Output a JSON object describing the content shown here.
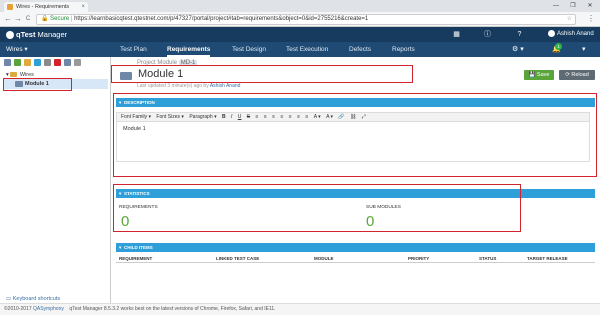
{
  "browser": {
    "tab_title": "Wires - Requirements",
    "tab_close": "×",
    "secure_label": "Secure",
    "url": "https://learnbasicqtest.qtestnet.com/p/47327/portal/project#tab=requirements&object=0&id=2755216&create=1",
    "back": "←",
    "forward": "→",
    "refresh": "C",
    "star": "☆",
    "menu": "⋮",
    "win_min": "—",
    "win_max": "❐",
    "win_close": "✕"
  },
  "app": {
    "logo_text": "qTest",
    "logo_suffix": "Manager",
    "user_name": "Ashish Anand",
    "notification_count": "1"
  },
  "nav": {
    "project": "Wires ▾",
    "tabs": [
      "Test Plan",
      "Requirements",
      "Test Design",
      "Test Execution",
      "Defects",
      "Reports"
    ],
    "active_tab": "Requirements"
  },
  "tree": {
    "root": "Wires",
    "child": "Module 1"
  },
  "main": {
    "breadcrumb": "Project Module",
    "module_id": "MD-1",
    "title": "Module 1",
    "updated_prefix": "Last updated 3 minute(s) ago by",
    "updated_by": "Ashish Anand",
    "save_label": "Save",
    "reload_label": "Reload"
  },
  "description": {
    "header": "DESCRIPTION",
    "toolbar": [
      "Font Family ▾",
      "Font Sizes ▾",
      "Paragraph ▾",
      "B",
      "I",
      "U",
      "S",
      "≡",
      "≡",
      "≡",
      "≡",
      "≡",
      "≡",
      "≡",
      "A ▾",
      "A ▾",
      "🔗",
      "⛓",
      "⤢"
    ],
    "body": "Module 1"
  },
  "statistics": {
    "header": "STATISTICS",
    "requirements_label": "REQUIREMENTS",
    "requirements_value": "0",
    "submodules_label": "SUB MODULES",
    "submodules_value": "0"
  },
  "child_items": {
    "header": "CHILD ITEMS",
    "columns": [
      "REQUIREMENT",
      "LINKED TEST CASE",
      "MODULE",
      "PRIORITY",
      "STATUS",
      "TARGET RELEASE"
    ]
  },
  "footer": {
    "keyboard_shortcuts": "Keyboard shortcuts",
    "copyright": "©2010-2017",
    "company": "QASymphony",
    "notice": "qTest Manager 8.5.3.2 works best on the latest versions of Chrome, Firefox, Safari, and IE11."
  },
  "colors": {
    "header_dark": "#173b5f",
    "nav": "#1f4a73",
    "section_header": "#2e9fd8",
    "save_green": "#5aa53a",
    "highlight_red": "#d1242f"
  }
}
